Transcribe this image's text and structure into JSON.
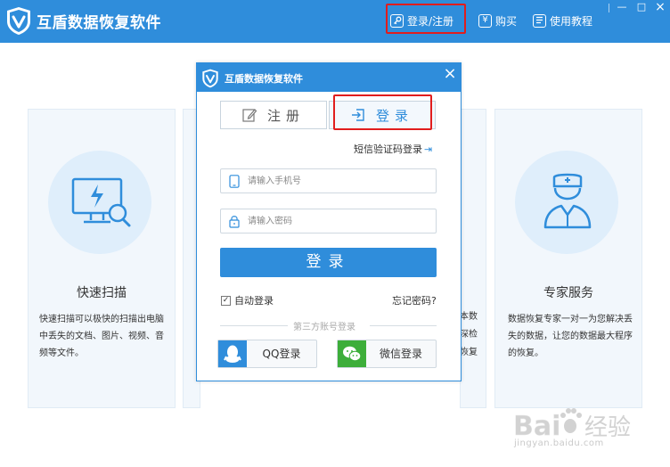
{
  "app": {
    "title": "互盾数据恢复软件",
    "accent_color": "#2f8ddb",
    "icon": "shield-v-logo-icon"
  },
  "header_nav": {
    "login_register_label": "登录/注册",
    "login_register_icon": "key-icon",
    "buy_label": "购买",
    "buy_icon": "yen-icon",
    "tutorial_label": "使用教程",
    "tutorial_icon": "book-icon"
  },
  "window_controls": {
    "minimize": "—",
    "maximize": "□",
    "close": "×"
  },
  "cards": [
    {
      "title": "快速扫描",
      "icon": "monitor-scan-icon",
      "desc": "快速扫描可以极快的扫描出电脑中丢失的文档、图片、视频、音频等文件。"
    },
    {
      "title": "专家服务",
      "icon": "nurse-expert-icon",
      "desc": "数据恢复专家一对一为您解决丢失的数据，让您的数据最大程序的恢复。"
    }
  ],
  "partial_card_fragments": [
    "本数",
    "深检",
    "恢复"
  ],
  "dialog": {
    "title": "互盾数据恢复软件",
    "close": "×",
    "tab_register": "注册",
    "tab_login": "登录",
    "sms_login_link": "短信验证码登录",
    "phone_placeholder": "请输入手机号",
    "phone_value": "",
    "password_placeholder": "请输入密码",
    "password_value": "",
    "login_button": "登录",
    "auto_login_label": "自动登录",
    "auto_login_checked": true,
    "forgot_password": "忘记密码?",
    "third_party_label": "第三方账号登录",
    "qq_label": "QQ登录",
    "wechat_label": "微信登录"
  },
  "watermark": {
    "text": "jingyan.baidu.com",
    "logo_text": "Bai 经验"
  },
  "highlight_color": "#e11d1d"
}
